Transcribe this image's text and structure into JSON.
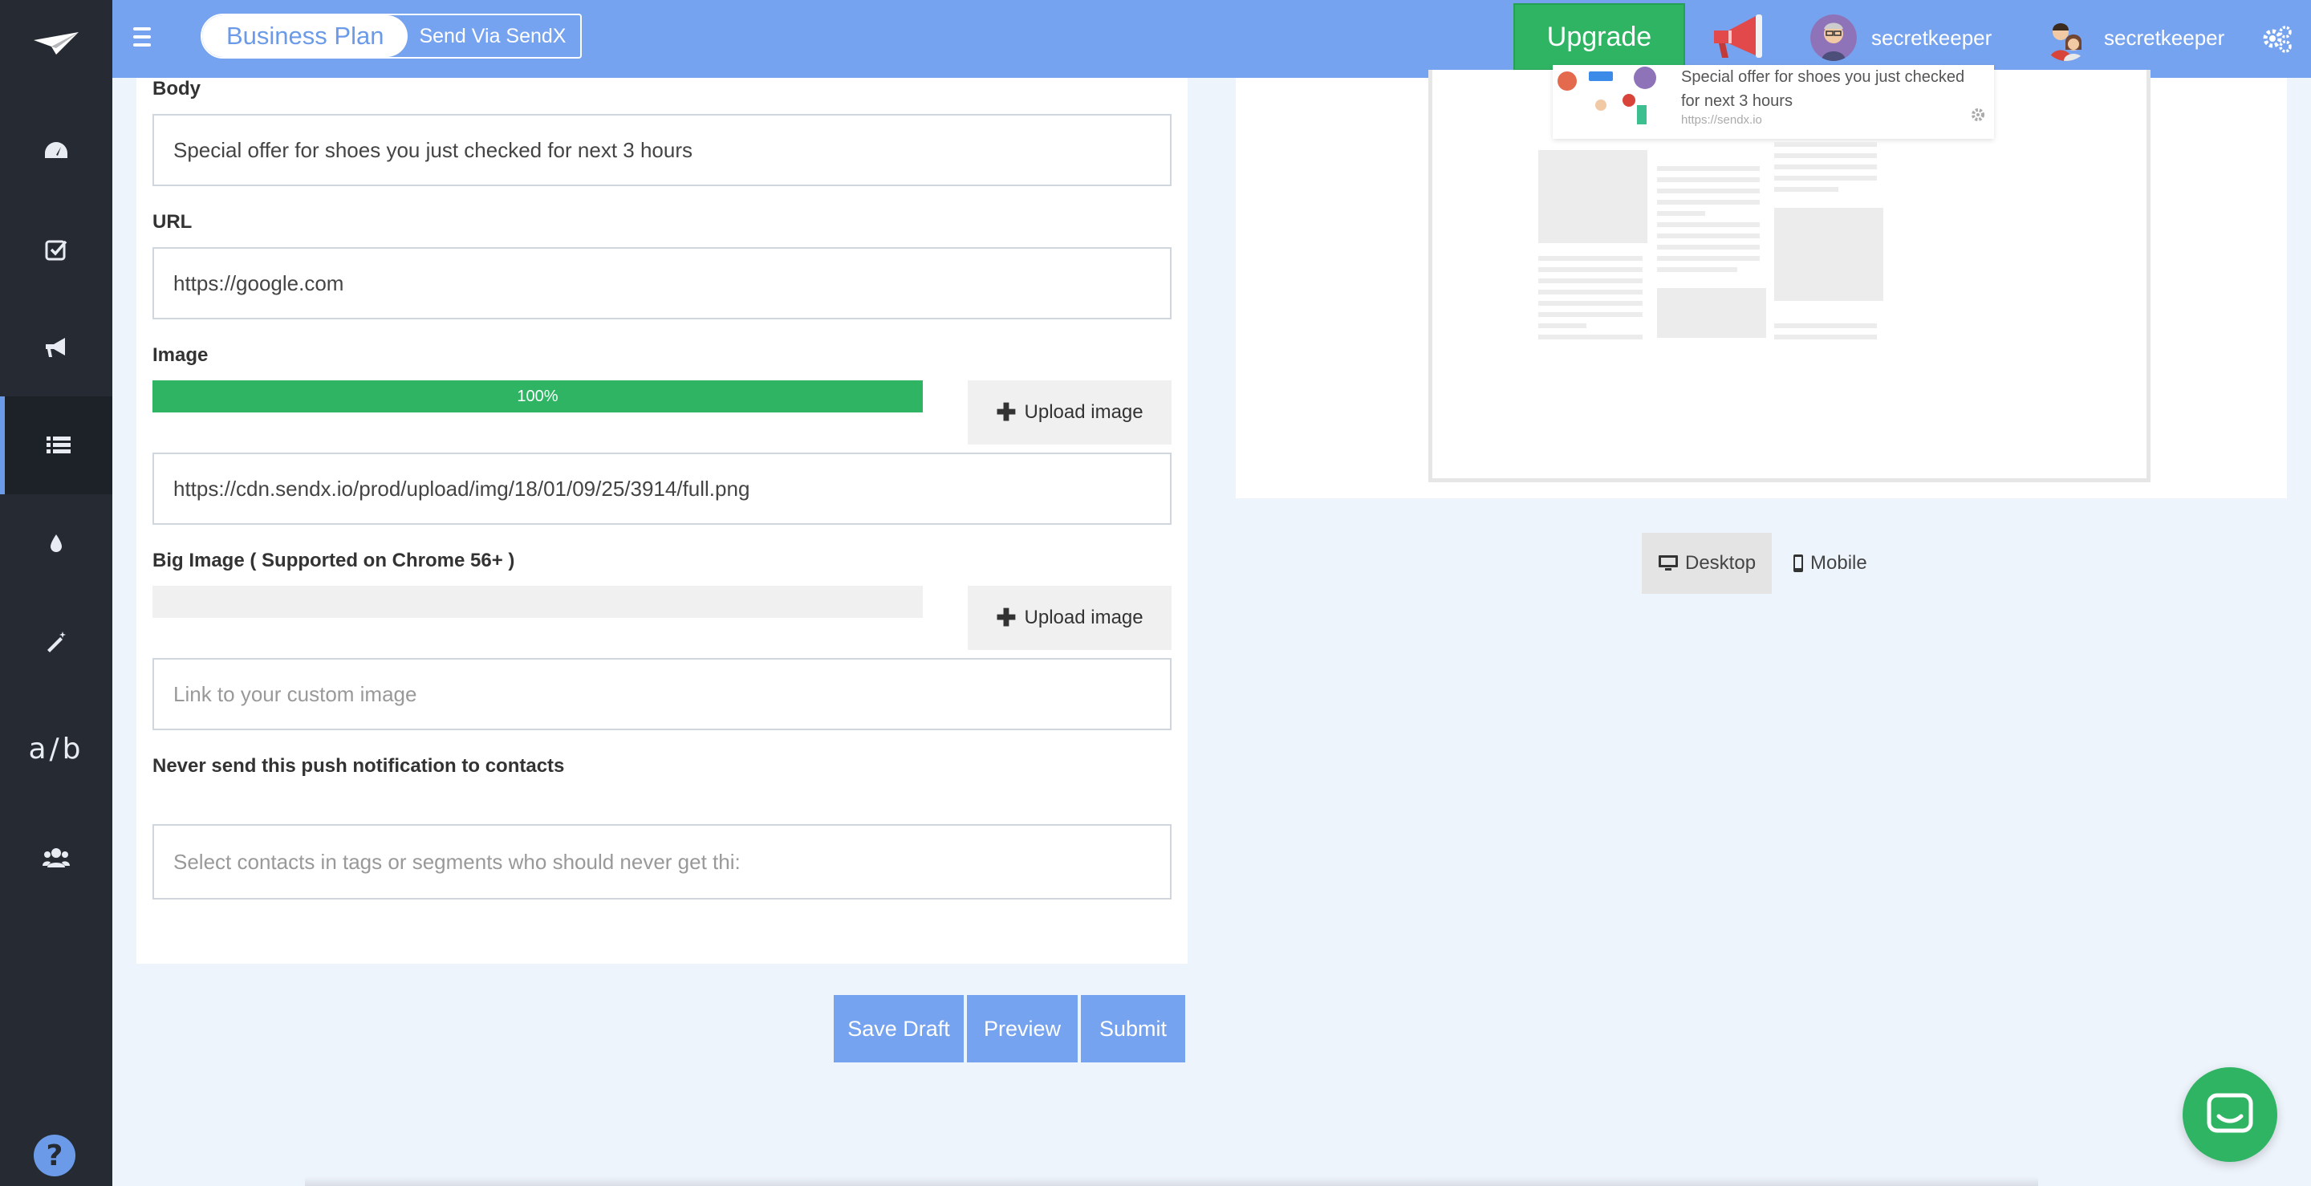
{
  "sidebar": {
    "items": [
      {
        "icon": "dashboard-icon"
      },
      {
        "icon": "checklist-icon"
      },
      {
        "icon": "megaphone-icon"
      },
      {
        "icon": "list-icon",
        "active": true
      },
      {
        "icon": "drop-icon"
      },
      {
        "icon": "magic-wand-icon"
      },
      {
        "icon": "ab-test-icon",
        "label": "a/b"
      },
      {
        "icon": "users-icon"
      }
    ],
    "help_label": "?"
  },
  "topbar": {
    "plan_label": "Business Plan",
    "send_label": "Send Via SendX",
    "upgrade_label": "Upgrade",
    "users": [
      {
        "name": "secretkeeper"
      },
      {
        "name": "secretkeeper"
      }
    ]
  },
  "form": {
    "body_label": "Body",
    "body_value": "Special offer for shoes you just checked for next 3 hours",
    "url_label": "URL",
    "url_value": "https://google.com",
    "image_label": "Image",
    "image_progress_label": "100%",
    "image_progress": 1.0,
    "upload_label": "Upload image",
    "image_url_value": "https://cdn.sendx.io/prod/upload/img/18/01/09/25/3914/full.png",
    "big_image_label": "Big Image ( Supported on Chrome 56+ )",
    "big_image_progress": 0,
    "big_image_placeholder": "Link to your custom image",
    "never_send_label": "Never send this push notification to contacts",
    "never_send_placeholder": "Select contacts in tags or segments who should never get thi:"
  },
  "actions": {
    "save_draft": "Save Draft",
    "preview": "Preview",
    "submit": "Submit"
  },
  "preview": {
    "notification_text": "Special offer for shoes you just checked for next 3 hours",
    "notification_url": "https://sendx.io",
    "desktop_label": "Desktop",
    "mobile_label": "Mobile",
    "active_view": "Desktop"
  },
  "colors": {
    "topbar": "#76a3ef",
    "sidebar": "#262b33",
    "accent_green": "#2fb464",
    "button_blue": "#76a3ef",
    "page_bg": "#eef4fc"
  }
}
